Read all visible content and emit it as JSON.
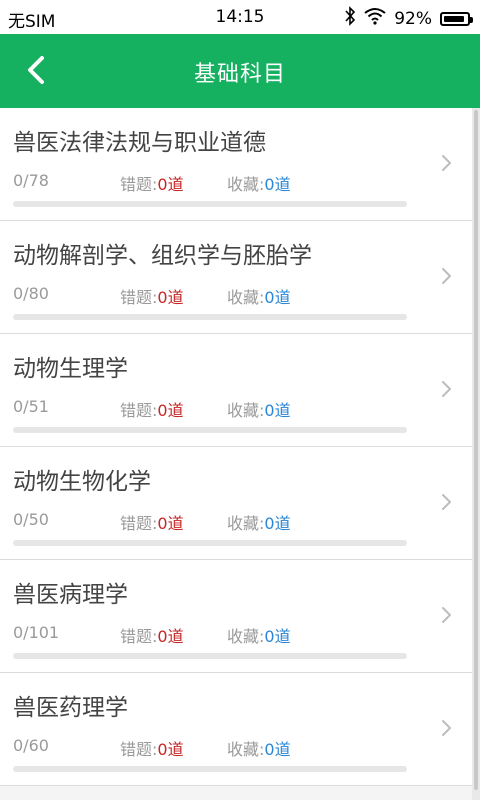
{
  "status_bar": {
    "carrier": "无SIM",
    "time": "14:15",
    "battery_percent": "92%",
    "battery_level": 0.92,
    "icons": [
      "bluetooth-icon",
      "wifi-icon",
      "battery-icon"
    ]
  },
  "header": {
    "title": "基础科目",
    "back_icon": "chevron-left-icon",
    "background_color": "#16b160"
  },
  "labels": {
    "wrong": "错题:",
    "favorite": "收藏:"
  },
  "colors": {
    "wrong_value": "#c62626",
    "favorite_value": "#2a86d6",
    "progress_track": "#e6e6e6"
  },
  "subjects": [
    {
      "title": "兽医法律法规与职业道德",
      "progress": "0/78",
      "done": 0,
      "total": 78,
      "wrong": "0道",
      "favorite": "0道"
    },
    {
      "title": "动物解剖学、组织学与胚胎学",
      "progress": "0/80",
      "done": 0,
      "total": 80,
      "wrong": "0道",
      "favorite": "0道"
    },
    {
      "title": "动物生理学",
      "progress": "0/51",
      "done": 0,
      "total": 51,
      "wrong": "0道",
      "favorite": "0道"
    },
    {
      "title": "动物生物化学",
      "progress": "0/50",
      "done": 0,
      "total": 50,
      "wrong": "0道",
      "favorite": "0道"
    },
    {
      "title": "兽医病理学",
      "progress": "0/101",
      "done": 0,
      "total": 101,
      "wrong": "0道",
      "favorite": "0道"
    },
    {
      "title": "兽医药理学",
      "progress": "0/60",
      "done": 0,
      "total": 60,
      "wrong": "0道",
      "favorite": "0道"
    }
  ]
}
